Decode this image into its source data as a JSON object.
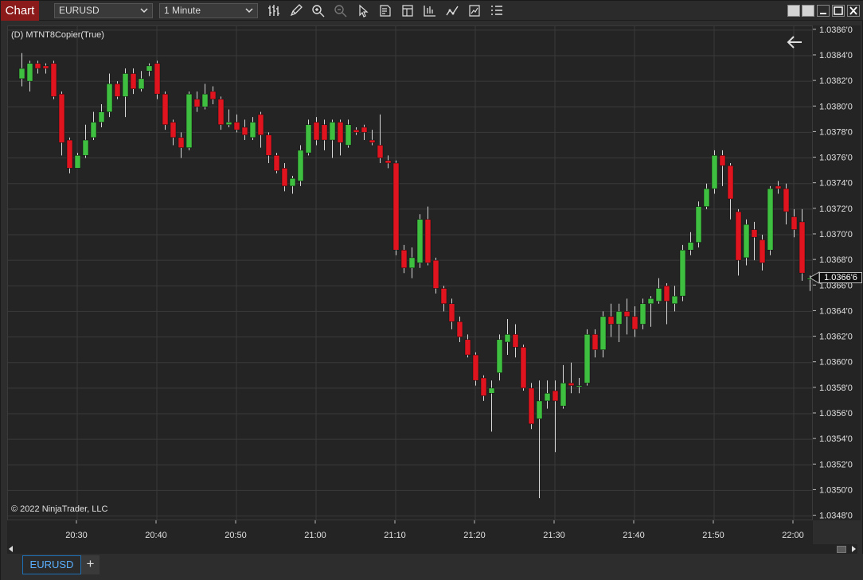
{
  "toolbar": {
    "chart_label": "Chart",
    "instrument": "EURUSD",
    "interval": "1 Minute",
    "icons": [
      "bars-type-icon",
      "pencil-draw-icon",
      "zoom-in-icon",
      "zoom-out-icon",
      "pointer-icon",
      "data-box-icon",
      "chart-properties-icon",
      "strategies-icon",
      "indicators-icon",
      "templates-icon",
      "list-menu-icon"
    ],
    "window_buttons": [
      "restore-icon",
      "restore-icon",
      "minimize-icon",
      "maximize-icon",
      "close-icon"
    ]
  },
  "chart": {
    "indicator_label": "(D) MTNT8Copier(True)",
    "copyright": "© 2022 NinjaTrader, LLC",
    "last_price": "1.0366'6",
    "colors": {
      "up": "#3fbf3f",
      "down": "#e0141e",
      "background": "#242424",
      "grid": "#3a3a3a",
      "wick": "#d8d8d8"
    }
  },
  "bottom_tabs": {
    "active": "EURUSD",
    "add": "+"
  },
  "chart_data": {
    "type": "candlestick",
    "price_labels": [
      "1.0386'0",
      "1.0384'0",
      "1.0382'0",
      "1.0380'0",
      "1.0378'0",
      "1.0376'0",
      "1.0374'0",
      "1.0372'0",
      "1.0370'0",
      "1.0368'0",
      "1.0366'0",
      "1.0364'0",
      "1.0362'0",
      "1.0360'0",
      "1.0358'0",
      "1.0356'0",
      "1.0354'0",
      "1.0352'0",
      "1.0350'0",
      "1.0348'0"
    ],
    "price_values": [
      1.0386,
      1.0384,
      1.0382,
      1.038,
      1.0378,
      1.0376,
      1.0374,
      1.0372,
      1.037,
      1.0368,
      1.0366,
      1.0364,
      1.0362,
      1.036,
      1.0358,
      1.0356,
      1.0354,
      1.0352,
      1.035,
      1.0348
    ],
    "time_labels": [
      "20:30",
      "20:40",
      "20:50",
      "21:00",
      "21:10",
      "21:20",
      "21:30",
      "21:40",
      "21:50",
      "22:00"
    ],
    "ylim": [
      1.03476,
      1.03863
    ],
    "first_bar_time": "20:23",
    "candles": [
      [
        1.03822,
        1.0383,
        1.03842,
        1.03816
      ],
      [
        1.0382,
        1.03834,
        1.03836,
        1.03812
      ],
      [
        1.03834,
        1.0383,
        1.03836,
        1.03826
      ],
      [
        1.03832,
        1.0383,
        1.03834,
        1.03826
      ],
      [
        1.03834,
        1.03808,
        1.03836,
        1.03806
      ],
      [
        1.0381,
        1.03772,
        1.03812,
        1.03762
      ],
      [
        1.03774,
        1.03752,
        1.03776,
        1.03748
      ],
      [
        1.03752,
        1.03762,
        1.03764,
        1.03756
      ],
      [
        1.03762,
        1.03774,
        1.03786,
        1.0376
      ],
      [
        1.03776,
        1.03788,
        1.03796,
        1.03774
      ],
      [
        1.03788,
        1.03796,
        1.03802,
        1.03784
      ],
      [
        1.03796,
        1.03818,
        1.03826,
        1.03792
      ],
      [
        1.03818,
        1.03808,
        1.0382,
        1.03806
      ],
      [
        1.03808,
        1.03826,
        1.0383,
        1.03792
      ],
      [
        1.03826,
        1.03814,
        1.0383,
        1.0381
      ],
      [
        1.03814,
        1.03822,
        1.03828,
        1.03812
      ],
      [
        1.03828,
        1.03832,
        1.03834,
        1.03824
      ],
      [
        1.03834,
        1.0381,
        1.03836,
        1.03806
      ],
      [
        1.0381,
        1.03786,
        1.03812,
        1.03782
      ],
      [
        1.03788,
        1.03776,
        1.0379,
        1.0377
      ],
      [
        1.03776,
        1.03768,
        1.0378,
        1.0376
      ],
      [
        1.03768,
        1.0381,
        1.03812,
        1.03766
      ],
      [
        1.03806,
        1.038,
        1.03812,
        1.03796
      ],
      [
        1.038,
        1.0381,
        1.03818,
        1.03798
      ],
      [
        1.03812,
        1.03806,
        1.03816,
        1.03802
      ],
      [
        1.03806,
        1.03786,
        1.03808,
        1.03782
      ],
      [
        1.03786,
        1.03788,
        1.03798,
        1.03784
      ],
      [
        1.03788,
        1.03782,
        1.03794,
        1.0378
      ],
      [
        1.03784,
        1.03778,
        1.0379,
        1.03774
      ],
      [
        1.03776,
        1.03788,
        1.03792,
        1.03774
      ],
      [
        1.03794,
        1.03778,
        1.03796,
        1.03768
      ],
      [
        1.03778,
        1.03762,
        1.0378,
        1.03756
      ],
      [
        1.03762,
        1.0375,
        1.03764,
        1.03748
      ],
      [
        1.03752,
        1.03738,
        1.03756,
        1.03734
      ],
      [
        1.03738,
        1.03744,
        1.03746,
        1.03732
      ],
      [
        1.03742,
        1.03766,
        1.0377,
        1.03738
      ],
      [
        1.03764,
        1.03786,
        1.0379,
        1.03762
      ],
      [
        1.03788,
        1.03774,
        1.03792,
        1.0377
      ],
      [
        1.03786,
        1.03774,
        1.0379,
        1.03766
      ],
      [
        1.03774,
        1.03788,
        1.0379,
        1.0376
      ],
      [
        1.03788,
        1.03772,
        1.0379,
        1.03762
      ],
      [
        1.0377,
        1.03786,
        1.0379,
        1.03768
      ],
      [
        1.03782,
        1.0378,
        1.03784,
        1.03778
      ],
      [
        1.03784,
        1.0378,
        1.03786,
        1.03774
      ],
      [
        1.03774,
        1.03772,
        1.03782,
        1.0377
      ],
      [
        1.0377,
        1.0376,
        1.03794,
        1.03756
      ],
      [
        1.03758,
        1.03756,
        1.03762,
        1.03752
      ],
      [
        1.03756,
        1.03688,
        1.03758,
        1.03684
      ],
      [
        1.03688,
        1.03674,
        1.03692,
        1.0367
      ],
      [
        1.03674,
        1.03682,
        1.0369,
        1.03666
      ],
      [
        1.03678,
        1.03712,
        1.03716,
        1.03674
      ],
      [
        1.03712,
        1.03678,
        1.03722,
        1.03676
      ],
      [
        1.0368,
        1.03658,
        1.03682,
        1.03654
      ],
      [
        1.03658,
        1.03646,
        1.0366,
        1.0364
      ],
      [
        1.03646,
        1.03632,
        1.0365,
        1.03626
      ],
      [
        1.03632,
        1.0362,
        1.03636,
        1.03616
      ],
      [
        1.03618,
        1.03606,
        1.03622,
        1.03604
      ],
      [
        1.03606,
        1.03586,
        1.03608,
        1.03582
      ],
      [
        1.03588,
        1.03574,
        1.0359,
        1.0357
      ],
      [
        1.03576,
        1.0358,
        1.03586,
        1.03546
      ],
      [
        1.03592,
        1.03618,
        1.03622,
        1.03586
      ],
      [
        1.03616,
        1.03622,
        1.03634,
        1.03606
      ],
      [
        1.03622,
        1.03612,
        1.0363,
        1.03604
      ],
      [
        1.03612,
        1.0358,
        1.03614,
        1.03578
      ],
      [
        1.0358,
        1.03552,
        1.03584,
        1.03548
      ],
      [
        1.03556,
        1.0357,
        1.03586,
        1.03494
      ],
      [
        1.0357,
        1.03576,
        1.03586,
        1.03564
      ],
      [
        1.03578,
        1.0357,
        1.03586,
        1.0353
      ],
      [
        1.03566,
        1.03584,
        1.03598,
        1.03564
      ],
      [
        1.03584,
        1.03582,
        1.036,
        1.03576
      ],
      [
        1.03582,
        1.03582,
        1.03588,
        1.03576
      ],
      [
        1.03584,
        1.03622,
        1.03626,
        1.03582
      ],
      [
        1.03622,
        1.0361,
        1.03626,
        1.03604
      ],
      [
        1.0361,
        1.03636,
        1.0364,
        1.03604
      ],
      [
        1.03636,
        1.0363,
        1.03646,
        1.0362
      ],
      [
        1.0363,
        1.0364,
        1.03646,
        1.03616
      ],
      [
        1.0364,
        1.03636,
        1.0365,
        1.03622
      ],
      [
        1.03636,
        1.03626,
        1.03644,
        1.0362
      ],
      [
        1.0363,
        1.03646,
        1.0365,
        1.03626
      ],
      [
        1.03646,
        1.0365,
        1.03652,
        1.03628
      ],
      [
        1.03648,
        1.03658,
        1.03666,
        1.03646
      ],
      [
        1.0366,
        1.03648,
        1.03662,
        1.0363
      ],
      [
        1.03646,
        1.03652,
        1.0366,
        1.0364
      ],
      [
        1.03652,
        1.03688,
        1.03692,
        1.03648
      ],
      [
        1.03688,
        1.03694,
        1.03702,
        1.03684
      ],
      [
        1.03694,
        1.03722,
        1.03726,
        1.0369
      ],
      [
        1.03722,
        1.03736,
        1.0374,
        1.0372
      ],
      [
        1.03736,
        1.03762,
        1.03766,
        1.03732
      ],
      [
        1.03762,
        1.03754,
        1.03766,
        1.03738
      ],
      [
        1.03754,
        1.03728,
        1.03756,
        1.03712
      ],
      [
        1.03718,
        1.0368,
        1.0372,
        1.03668
      ],
      [
        1.03682,
        1.03708,
        1.03712,
        1.03676
      ],
      [
        1.03704,
        1.03698,
        1.0371,
        1.0368
      ],
      [
        1.03696,
        1.03678,
        1.037,
        1.03672
      ],
      [
        1.03688,
        1.03736,
        1.03738,
        1.03684
      ],
      [
        1.03738,
        1.03736,
        1.03742,
        1.03732
      ],
      [
        1.03736,
        1.03718,
        1.0374,
        1.03708
      ],
      [
        1.03714,
        1.03704,
        1.0372,
        1.03698
      ],
      [
        1.0371,
        1.0367,
        1.0372,
        1.03664
      ],
      [
        1.03666,
        1.03666,
        1.03668,
        1.03656
      ]
    ]
  }
}
